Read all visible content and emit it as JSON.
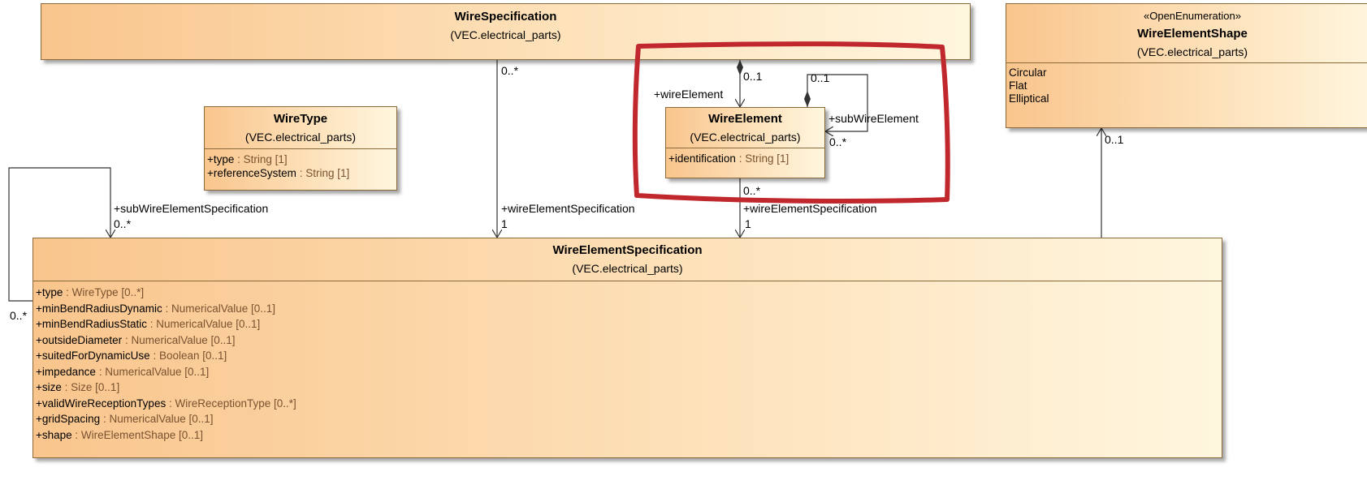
{
  "classes": {
    "wire_specification": {
      "name": "WireSpecification",
      "package": "(VEC.electrical_parts)"
    },
    "wire_element_shape": {
      "stereotype": "«OpenEnumeration»",
      "name": "WireElementShape",
      "package": "(VEC.electrical_parts)",
      "literals": [
        "Circular",
        "Flat",
        "Elliptical"
      ]
    },
    "wire_type": {
      "name": "WireType",
      "package": "(VEC.electrical_parts)",
      "attributes": [
        {
          "name": "+type",
          "type": " : String [1]"
        },
        {
          "name": "+referenceSystem",
          "type": " : String [1]"
        }
      ]
    },
    "wire_element": {
      "name": "WireElement",
      "package": "(VEC.electrical_parts)",
      "attributes": [
        {
          "name": "+identification",
          "type": " : String [1]"
        }
      ]
    },
    "wire_element_specification": {
      "name": "WireElementSpecification",
      "package": "(VEC.electrical_parts)",
      "attributes": [
        {
          "name": "+type",
          "type": " : WireType [0..*]"
        },
        {
          "name": "+minBendRadiusDynamic",
          "type": " : NumericalValue [0..1]"
        },
        {
          "name": "+minBendRadiusStatic",
          "type": " : NumericalValue [0..1]"
        },
        {
          "name": "+outsideDiameter",
          "type": " : NumericalValue [0..1]"
        },
        {
          "name": "+suitedForDynamicUse",
          "type": " : Boolean [0..1]"
        },
        {
          "name": "+impedance",
          "type": " : NumericalValue [0..1]"
        },
        {
          "name": "+size",
          "type": " : Size [0..1]"
        },
        {
          "name": "+validWireReceptionTypes",
          "type": " : WireReceptionType [0..*]"
        },
        {
          "name": "+gridSpacing",
          "type": " : NumericalValue [0..1]"
        },
        {
          "name": "+shape",
          "type": " : WireElementShape [0..1]"
        }
      ]
    }
  },
  "association_labels": {
    "self_multiplicity_left": "0..*",
    "sub_wire_element_spec_role": "+subWireElementSpecification",
    "sub_wire_element_spec_mult": "0..*",
    "spec_to_wes_mult_top": "0..*",
    "spec_to_wes_role": "+wireElementSpecification",
    "spec_to_wes_mult_bottom": "1",
    "we_comp_mult": "0..1",
    "we_role": "+wireElement",
    "we_self_mult_top": "0..1",
    "we_self_role": "+subWireElement",
    "we_self_mult_bottom": "0..*",
    "we_to_wes_mult_top": "0..*",
    "we_to_wes_role": "+wireElementSpecification",
    "we_to_wes_mult_bottom": "1",
    "shape_mult": "0..1"
  },
  "highlight_color": "#c0282d"
}
